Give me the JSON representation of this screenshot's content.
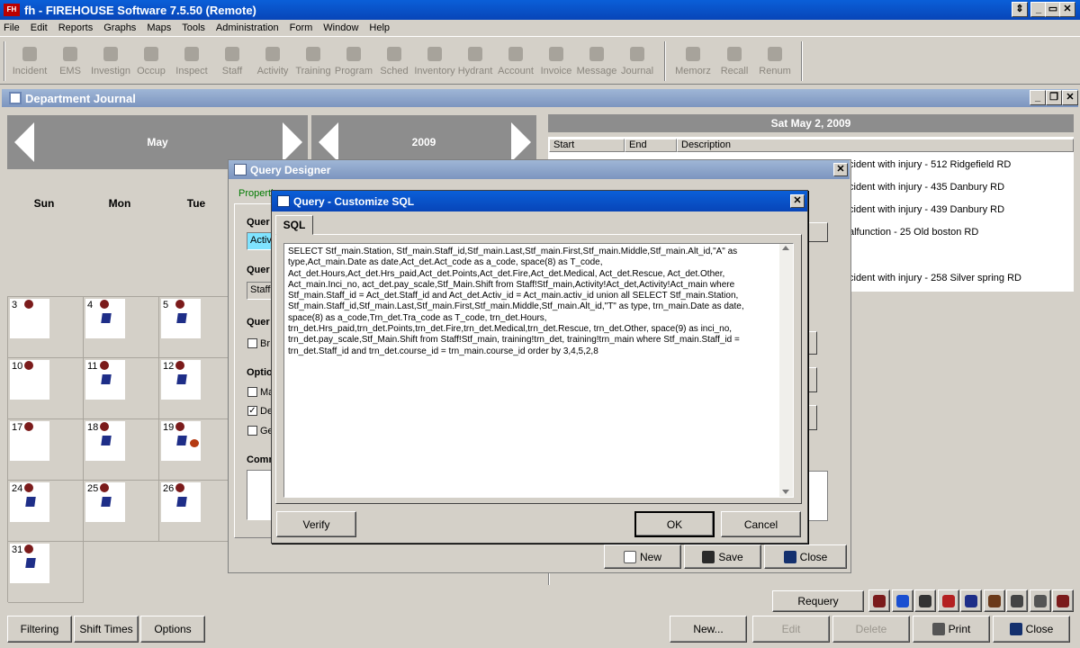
{
  "app": {
    "title": "fh - FIREHOUSE Software 7.5.50 (Remote)",
    "logo_text": "FH"
  },
  "menu": [
    "File",
    "Edit",
    "Reports",
    "Graphs",
    "Maps",
    "Tools",
    "Administration",
    "Form",
    "Window",
    "Help"
  ],
  "toolbar": [
    "Incident",
    "EMS",
    "Investign",
    "Occup",
    "Inspect",
    "Staff",
    "Activity",
    "Training",
    "Program",
    "Sched",
    "Inventory",
    "Hydrant",
    "Account",
    "Invoice",
    "Message",
    "Journal",
    "Memorz",
    "Recall",
    "Renum"
  ],
  "journal": {
    "title": "Department Journal",
    "month": "May",
    "year": "2009",
    "day_headers": [
      "Sun",
      "Mon",
      "Tue"
    ],
    "days": [
      {
        "n": "3",
        "icons": [
          "fire"
        ]
      },
      {
        "n": "4",
        "icons": [
          "fire",
          "book"
        ]
      },
      {
        "n": "5",
        "icons": [
          "fire",
          "book"
        ]
      },
      {
        "n": "10",
        "icons": [
          "fire"
        ]
      },
      {
        "n": "11",
        "icons": [
          "fire",
          "book"
        ]
      },
      {
        "n": "12",
        "icons": [
          "fire",
          "book"
        ]
      },
      {
        "n": "17",
        "icons": [
          "fire"
        ]
      },
      {
        "n": "18",
        "icons": [
          "fire",
          "book"
        ]
      },
      {
        "n": "19",
        "icons": [
          "fire",
          "book",
          "medic"
        ]
      },
      {
        "n": "24",
        "icons": [
          "fire",
          "book"
        ]
      },
      {
        "n": "25",
        "icons": [
          "fire",
          "book"
        ]
      },
      {
        "n": "26",
        "icons": [
          "fire",
          "book"
        ]
      },
      {
        "n": "31",
        "icons": [
          "fire",
          "book"
        ]
      }
    ],
    "buttons": {
      "filtering": "Filtering",
      "shift_times": "Shift Times",
      "options": "Options"
    }
  },
  "day_panel": {
    "title": "Sat May 2, 2009",
    "columns": [
      "Start",
      "End",
      "Description"
    ],
    "events": [
      "cident with injury - 512 Ridgefield RD",
      "cident with injury - 435 Danbury RD",
      "cident with injury - 439 Danbury RD",
      "alfunction - 25 Old boston RD",
      "",
      "cident with injury - 258 Silver spring RD"
    ],
    "buttons": {
      "requery": "Requery",
      "new": "New...",
      "edit": "Edit",
      "delete": "Delete",
      "print": "Print",
      "close": "Close"
    }
  },
  "query_designer": {
    "title": "Query Designer",
    "tab_properties": "Properti",
    "labels": [
      "Quer",
      "Quer",
      "Quer",
      "Optio",
      "Comn"
    ],
    "field1": "Activ",
    "field2": "Staff",
    "checks": [
      {
        "label": "Br",
        "checked": false
      },
      {
        "label": "Ma",
        "checked": false
      },
      {
        "label": "De",
        "checked": true
      },
      {
        "label": "Ge",
        "checked": false
      }
    ],
    "buttons": {
      "new": "New",
      "save": "Save",
      "close": "Close"
    }
  },
  "sql_dialog": {
    "title": "Query - Customize SQL",
    "tab": "SQL",
    "sql": "SELECT Stf_main.Station, Stf_main.Staff_id,Stf_main.Last,Stf_main.First,Stf_main.Middle,Stf_main.Alt_id,\"A\" as type,Act_main.Date as date,Act_det.Act_code as a_code, space(8) as T_code, Act_det.Hours,Act_det.Hrs_paid,Act_det.Points,Act_det.Fire,Act_det.Medical, Act_det.Rescue, Act_det.Other, Act_main.Inci_no, act_det.pay_scale,Stf_Main.Shift from Staff!Stf_main,Activity!Act_det,Activity!Act_main where Stf_main.Staff_id = Act_det.Staff_id and Act_det.Activ_id = Act_main.activ_id union all SELECT Stf_main.Station, Stf_main.Staff_id,Stf_main.Last,Stf_main.First,Stf_main.Middle,Stf_main.Alt_id,\"T\" as type, trn_main.Date as date, space(8) as a_code,Trn_det.Tra_code as T_code, trn_det.Hours, trn_det.Hrs_paid,trn_det.Points,trn_det.Fire,trn_det.Medical,trn_det.Rescue, trn_det.Other, space(9) as inci_no, trn_det.pay_scale,Stf_Main.Shift from Staff!Stf_main, training!trn_det, training!trn_main where Stf_main.Staff_id = trn_det.Staff_id and trn_det.course_id = trn_main.course_id order by 3,4,5,2,8",
    "buttons": {
      "verify": "Verify",
      "ok": "OK",
      "cancel": "Cancel"
    }
  }
}
